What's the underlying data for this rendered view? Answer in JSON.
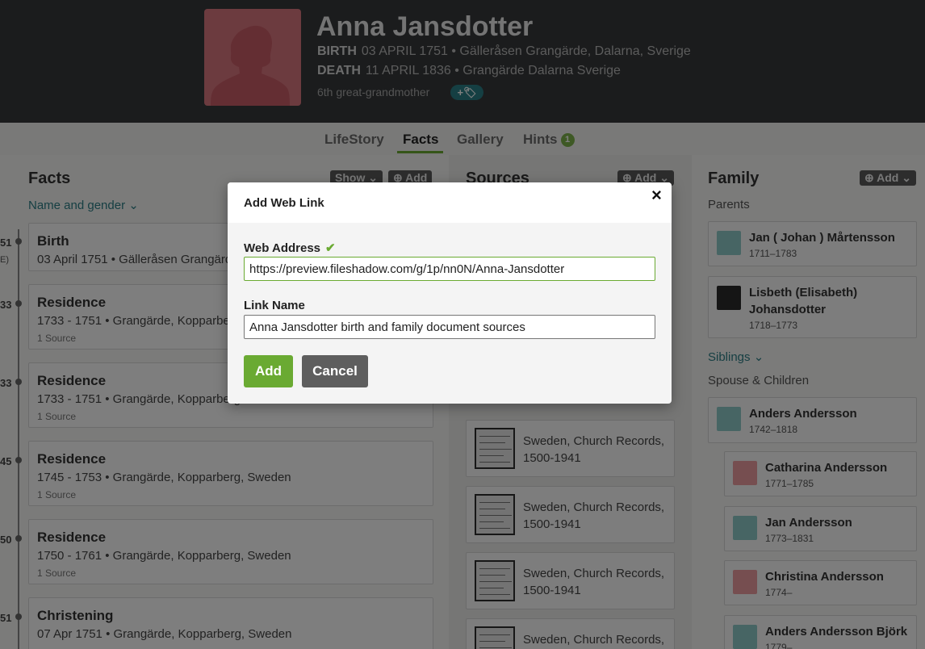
{
  "person": {
    "name": "Anna Jansdotter",
    "birth_label": "BIRTH",
    "birth_value": "03 APRIL 1751 • Gälleråsen Grangärde, Dalarna, Sverige",
    "death_label": "DEATH",
    "death_value": "11 APRIL 1836 • Grangärde Dalarna Sverige",
    "relation": "6th great-grandmother",
    "tag_button": "+🏷"
  },
  "tabs": [
    {
      "label": "LifeStory"
    },
    {
      "label": "Facts"
    },
    {
      "label": "Gallery"
    },
    {
      "label": "Hints",
      "badge": "1"
    }
  ],
  "facts": {
    "title": "Facts",
    "show_button": "Show ⌄",
    "add_button": "⊕ Add",
    "filter": "Name and gender ⌄",
    "years": [
      "51",
      "E)",
      "33",
      "33",
      "45",
      "50",
      "51"
    ],
    "items": [
      {
        "title": "Birth",
        "detail": "03 April 1751 • Gälleråsen Grangärde",
        "sources": ""
      },
      {
        "title": "Residence",
        "detail": "1733 - 1751 • Grangärde, Kopparberg",
        "sources": "1 Source"
      },
      {
        "title": "Residence",
        "detail": "1733 - 1751 • Grangärde, Kopparberg",
        "sources": "1 Source"
      },
      {
        "title": "Residence",
        "detail": "1745 - 1753 • Grangärde, Kopparberg, Sweden",
        "sources": "1 Source"
      },
      {
        "title": "Residence",
        "detail": "1750 - 1761 • Grangärde, Kopparberg, Sweden",
        "sources": "1 Source"
      },
      {
        "title": "Christening",
        "detail": "07 Apr 1751 • Grangärde, Kopparberg, Sweden",
        "sources": ""
      }
    ]
  },
  "sources": {
    "title": "Sources",
    "add_button": "⊕ Add ⌄",
    "items": [
      {
        "text": "Sweden, Church Records, 1500-1941"
      },
      {
        "text": "Sweden, Church Records, 1500-1941"
      },
      {
        "text": "Sweden, Church Records, 1500-1941"
      },
      {
        "text": "Sweden, Church Records,"
      }
    ]
  },
  "family": {
    "title": "Family",
    "add_button": "⊕ Add ⌄",
    "parents_label": "Parents",
    "siblings_label": "Siblings ⌄",
    "spouse_label": "Spouse & Children",
    "parents": [
      {
        "name": "Jan ( Johan ) Mårtensson",
        "dates": "1711–1783"
      },
      {
        "name": "Lisbeth (Elisabeth) Johansdotter",
        "dates": "1718–1773"
      }
    ],
    "spouse": {
      "name": "Anders Andersson",
      "dates": "1742–1818"
    },
    "children": [
      {
        "name": "Catharina Andersson",
        "dates": "1771–1785"
      },
      {
        "name": "Jan Andersson",
        "dates": "1773–1831"
      },
      {
        "name": "Christina Andersson",
        "dates": "1774–"
      },
      {
        "name": "Anders Andersson Björk",
        "dates": "1779–"
      }
    ]
  },
  "modal": {
    "title": "Add Web Link",
    "close": "×",
    "web_address_label": "Web Address",
    "web_address_value": "https://preview.fileshadow.com/g/1p/nn0N/Anna-Jansdotter",
    "link_name_label": "Link Name",
    "link_name_value": "Anna Jansdotter birth and family document sources",
    "add_button": "Add",
    "cancel_button": "Cancel"
  },
  "colors": {
    "header_bg": "#36393b",
    "accent_green": "#6aaa32",
    "link_teal": "#2c7e86",
    "female_avatar": "#d9777f",
    "male_avatar": "#8fcbc8"
  }
}
